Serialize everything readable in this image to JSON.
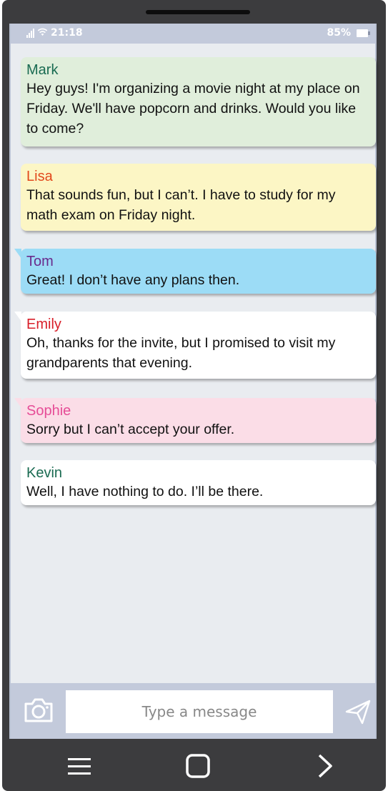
{
  "status_bar": {
    "time": "21:18",
    "battery": "85%"
  },
  "messages": [
    {
      "sender": "Mark",
      "text": "Hey guys! I'm organizing a movie night at my place on Friday. We'll have popcorn and drinks. Would you like to come?",
      "color": "#1a6b52",
      "bg": "#e0eedb"
    },
    {
      "sender": "Lisa",
      "text": "That sounds fun, but I can’t. I have to study for my math exam on Friday night.",
      "color": "#e2481c",
      "bg": "#fcf6c5"
    },
    {
      "sender": "Tom",
      "text": "Great! I don’t have any plans then.",
      "color": "#6a2a8c",
      "bg": "#9cdcf6"
    },
    {
      "sender": "Emily",
      "text": "Oh, thanks for the invite, but I promised to visit my grandparents that evening.",
      "color": "#d81f2a",
      "bg": "#ffffff"
    },
    {
      "sender": "Sophie",
      "text": "Sorry but I can’t accept your offer.",
      "color": "#e64d97",
      "bg": "#fbdde7"
    },
    {
      "sender": "Kevin",
      "text": "Well, I have nothing to do. I’ll be there.",
      "color": "#1a6b52",
      "bg": "#ffffff"
    }
  ],
  "input": {
    "placeholder": "Type a message",
    "value": ""
  },
  "icons": {
    "camera": "camera-icon",
    "send": "send-icon",
    "menu": "menu-icon",
    "home": "home-icon",
    "back": "chevron-right-icon"
  }
}
